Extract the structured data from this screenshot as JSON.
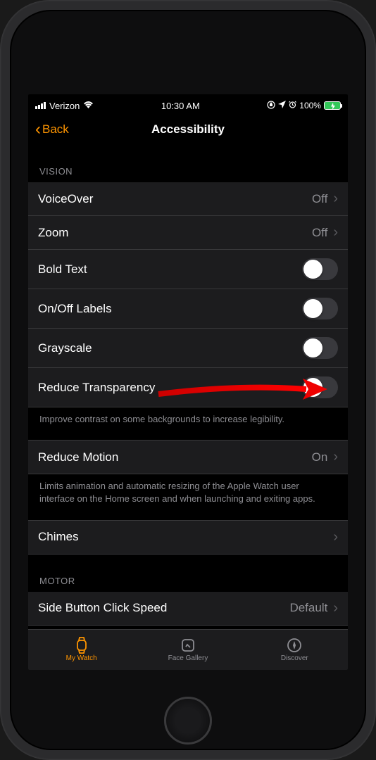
{
  "status_bar": {
    "carrier": "Verizon",
    "time": "10:30 AM",
    "battery_pct": "100%"
  },
  "nav": {
    "back_label": "Back",
    "title": "Accessibility"
  },
  "sections": {
    "vision_header": "VISION",
    "motor_header": "MOTOR"
  },
  "rows": {
    "voiceover": {
      "label": "VoiceOver",
      "value": "Off"
    },
    "zoom": {
      "label": "Zoom",
      "value": "Off"
    },
    "bold_text": {
      "label": "Bold Text"
    },
    "onoff_labels": {
      "label": "On/Off Labels"
    },
    "grayscale": {
      "label": "Grayscale"
    },
    "reduce_transparency": {
      "label": "Reduce Transparency"
    },
    "reduce_motion": {
      "label": "Reduce Motion",
      "value": "On"
    },
    "chimes": {
      "label": "Chimes"
    },
    "side_button": {
      "label": "Side Button Click Speed",
      "value": "Default"
    }
  },
  "footers": {
    "transparency": "Improve contrast on some backgrounds to increase legibility.",
    "motion": "Limits animation and automatic resizing of the Apple Watch user interface on the Home screen and when launching and exiting apps."
  },
  "tabs": {
    "my_watch": "My Watch",
    "face_gallery": "Face Gallery",
    "discover": "Discover"
  }
}
